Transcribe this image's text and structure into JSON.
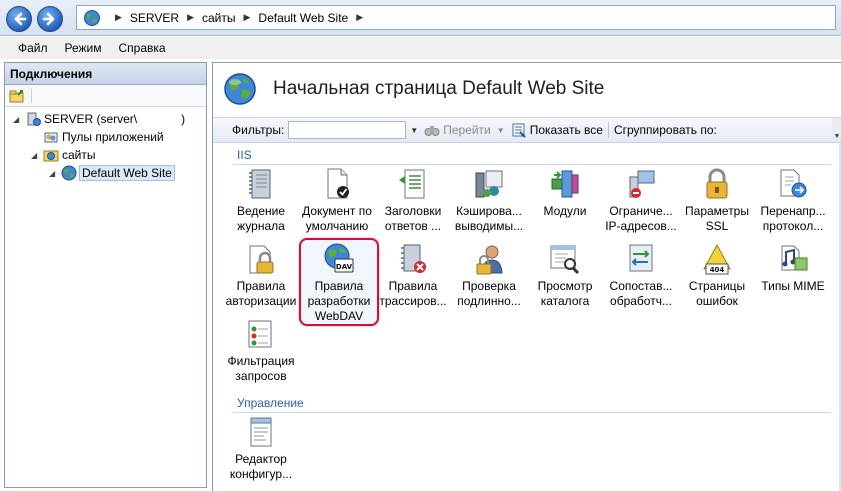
{
  "address_bar": {
    "back_icon": "back-arrow-icon",
    "forward_icon": "forward-arrow-icon",
    "breadcrumb": [
      "SERVER",
      "сайты",
      "Default Web Site"
    ],
    "separator": "▶"
  },
  "menu": {
    "items": [
      "Файл",
      "Режим",
      "Справка"
    ]
  },
  "connections": {
    "title": "Подключения",
    "tree": [
      {
        "label": "SERVER (server\\",
        "suffix": ")",
        "expander": "◢",
        "icon": "server-icon"
      },
      {
        "label": "Пулы приложений",
        "expander": "",
        "icon": "app-pools-icon"
      },
      {
        "label": "сайты",
        "expander": "◢",
        "icon": "sites-folder-icon"
      },
      {
        "label": "Default Web Site",
        "expander": "◢",
        "icon": "website-globe-icon",
        "selected": true
      }
    ]
  },
  "main": {
    "title": "Начальная страница Default Web Site",
    "filter": {
      "label": "Фильтры:",
      "value": "",
      "go_label": "Перейти",
      "show_all_label": "Показать все",
      "group_by_label": "Сгруппировать по:"
    },
    "sections": [
      {
        "name": "IIS",
        "features": [
          {
            "label": "Ведение\nжурнала",
            "icon": "logging-icon"
          },
          {
            "label": "Документ по\nумолчанию",
            "icon": "default-document-icon"
          },
          {
            "label": "Заголовки\nответов ...",
            "icon": "response-headers-icon"
          },
          {
            "label": "Кэширова...\nвыводимы...",
            "icon": "output-caching-icon"
          },
          {
            "label": "Модули",
            "icon": "modules-icon"
          },
          {
            "label": "Ограниче...\nIP-адресов...",
            "icon": "ip-restrictions-icon"
          },
          {
            "label": "Параметры\nSSL",
            "icon": "ssl-lock-icon"
          },
          {
            "label": "Перенапр...\nпротокол...",
            "icon": "http-redirect-icon"
          },
          {
            "label": "Правила\nавторизации",
            "icon": "authorization-icon"
          },
          {
            "label": "Правила\nразработки\nWebDAV",
            "icon": "webdav-icon",
            "highlighted": true
          },
          {
            "label": "Правила\nтрассиров...",
            "icon": "tracing-icon"
          },
          {
            "label": "Проверка\nподлинно...",
            "icon": "authentication-icon"
          },
          {
            "label": "Просмотр\nкаталога",
            "icon": "directory-browsing-icon"
          },
          {
            "label": "Сопостав...\nобработч...",
            "icon": "handler-mappings-icon"
          },
          {
            "label": "Страницы\nошибок",
            "icon": "error-pages-icon"
          },
          {
            "label": "Типы MIME",
            "icon": "mime-types-icon"
          },
          {
            "label": "Фильтрация\nзапросов",
            "icon": "request-filtering-icon"
          }
        ]
      },
      {
        "name": "Управление",
        "features": [
          {
            "label": "Редактор\nконфигур...",
            "icon": "config-editor-icon"
          }
        ]
      }
    ],
    "webdav_icon_text": "DAV",
    "error_page_icon_text": "404"
  }
}
